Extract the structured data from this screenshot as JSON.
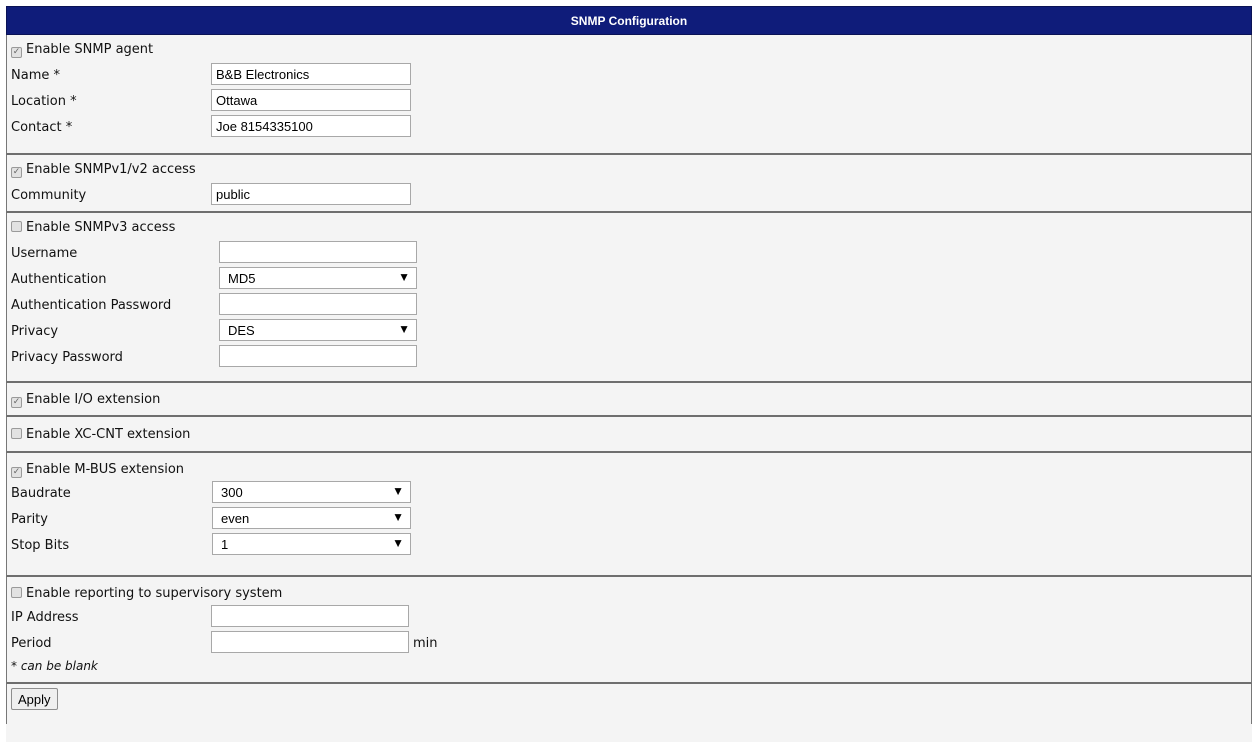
{
  "header": {
    "title": "SNMP Configuration"
  },
  "agent": {
    "enable_label": "Enable SNMP agent",
    "enabled": true,
    "name_label": "Name *",
    "name_value": "B&B Electronics",
    "location_label": "Location *",
    "location_value": "Ottawa",
    "contact_label": "Contact *",
    "contact_value": "Joe 8154335100"
  },
  "v1v2": {
    "enable_label": "Enable SNMPv1/v2 access",
    "enabled": true,
    "community_label": "Community",
    "community_value": "public"
  },
  "v3": {
    "enable_label": "Enable SNMPv3 access",
    "enabled": false,
    "username_label": "Username",
    "username_value": "",
    "auth_label": "Authentication",
    "auth_value": "MD5",
    "auth_password_label": "Authentication Password",
    "auth_password_value": "",
    "privacy_label": "Privacy",
    "privacy_value": "DES",
    "privacy_password_label": "Privacy Password",
    "privacy_password_value": ""
  },
  "io": {
    "enable_label": "Enable I/O extension",
    "enabled": true
  },
  "xccnt": {
    "enable_label": "Enable XC-CNT extension",
    "enabled": false
  },
  "mbus": {
    "enable_label": "Enable M-BUS extension",
    "enabled": true,
    "baudrate_label": "Baudrate",
    "baudrate_value": "300",
    "parity_label": "Parity",
    "parity_value": "even",
    "stopbits_label": "Stop Bits",
    "stopbits_value": "1"
  },
  "reporting": {
    "enable_label": "Enable reporting to supervisory system",
    "enabled": false,
    "ip_label": "IP Address",
    "ip_value": "",
    "period_label": "Period",
    "period_value": "",
    "period_unit": "min",
    "note_star": "*",
    "note_text": "can be blank"
  },
  "actions": {
    "apply_label": "Apply"
  },
  "icons": {
    "check": "checkmark-icon",
    "dropdown": "triangle-down-icon"
  }
}
